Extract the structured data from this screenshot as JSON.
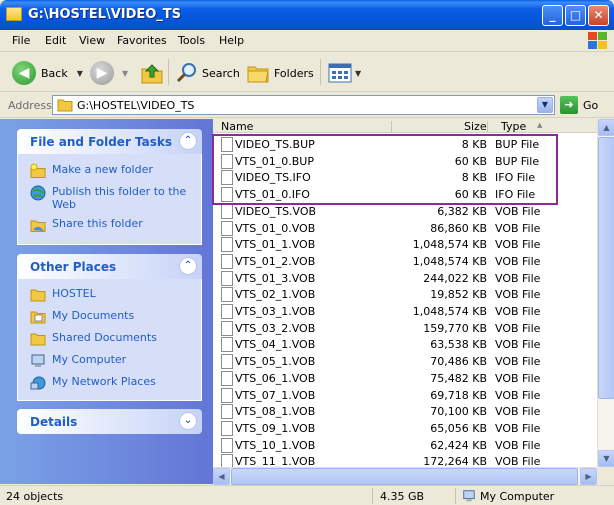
{
  "window": {
    "title": "G:\\HOSTEL\\VIDEO_TS"
  },
  "menu": [
    "File",
    "Edit",
    "View",
    "Favorites",
    "Tools",
    "Help"
  ],
  "toolbar": {
    "back_label": "Back",
    "search_label": "Search",
    "folders_label": "Folders"
  },
  "address": {
    "label": "Address",
    "value": "G:\\HOSTEL\\VIDEO_TS",
    "go_label": "Go"
  },
  "tasks_panel": {
    "title": "File and Folder Tasks",
    "items": [
      {
        "label": "Make a new folder",
        "icon": "new-folder-icon"
      },
      {
        "label": "Publish this folder to the Web",
        "icon": "web-publish-icon"
      },
      {
        "label": "Share this folder",
        "icon": "share-folder-icon"
      }
    ]
  },
  "places_panel": {
    "title": "Other Places",
    "items": [
      {
        "label": "HOSTEL",
        "icon": "folder-icon"
      },
      {
        "label": "My Documents",
        "icon": "my-documents-icon"
      },
      {
        "label": "Shared Documents",
        "icon": "shared-documents-icon"
      },
      {
        "label": "My Computer",
        "icon": "my-computer-icon"
      },
      {
        "label": "My Network Places",
        "icon": "network-places-icon"
      }
    ]
  },
  "details_panel": {
    "title": "Details"
  },
  "columns": {
    "name": "Name",
    "size": "Size",
    "type": "Type"
  },
  "files": [
    {
      "name": "VIDEO_TS.BUP",
      "size": "8 KB",
      "type": "BUP File"
    },
    {
      "name": "VTS_01_0.BUP",
      "size": "60 KB",
      "type": "BUP File"
    },
    {
      "name": "VIDEO_TS.IFO",
      "size": "8 KB",
      "type": "IFO File"
    },
    {
      "name": "VTS_01_0.IFO",
      "size": "60 KB",
      "type": "IFO File"
    },
    {
      "name": "VIDEO_TS.VOB",
      "size": "6,382 KB",
      "type": "VOB File"
    },
    {
      "name": "VTS_01_0.VOB",
      "size": "86,860 KB",
      "type": "VOB File"
    },
    {
      "name": "VTS_01_1.VOB",
      "size": "1,048,574 KB",
      "type": "VOB File"
    },
    {
      "name": "VTS_01_2.VOB",
      "size": "1,048,574 KB",
      "type": "VOB File"
    },
    {
      "name": "VTS_01_3.VOB",
      "size": "244,022 KB",
      "type": "VOB File"
    },
    {
      "name": "VTS_02_1.VOB",
      "size": "19,852 KB",
      "type": "VOB File"
    },
    {
      "name": "VTS_03_1.VOB",
      "size": "1,048,574 KB",
      "type": "VOB File"
    },
    {
      "name": "VTS_03_2.VOB",
      "size": "159,770 KB",
      "type": "VOB File"
    },
    {
      "name": "VTS_04_1.VOB",
      "size": "63,538 KB",
      "type": "VOB File"
    },
    {
      "name": "VTS_05_1.VOB",
      "size": "70,486 KB",
      "type": "VOB File"
    },
    {
      "name": "VTS_06_1.VOB",
      "size": "75,482 KB",
      "type": "VOB File"
    },
    {
      "name": "VTS_07_1.VOB",
      "size": "69,718 KB",
      "type": "VOB File"
    },
    {
      "name": "VTS_08_1.VOB",
      "size": "70,100 KB",
      "type": "VOB File"
    },
    {
      "name": "VTS_09_1.VOB",
      "size": "65,056 KB",
      "type": "VOB File"
    },
    {
      "name": "VTS_10_1.VOB",
      "size": "62,424 KB",
      "type": "VOB File"
    },
    {
      "name": "VTS_11_1.VOB",
      "size": "172,264 KB",
      "type": "VOB File"
    }
  ],
  "status": {
    "objects": "24 objects",
    "total_size": "4.35 GB",
    "location": "My Computer"
  },
  "colors": {
    "highlight_border": "#8b2a9a",
    "task_link": "#215dc6",
    "title_bar": "#0a5ee6"
  }
}
